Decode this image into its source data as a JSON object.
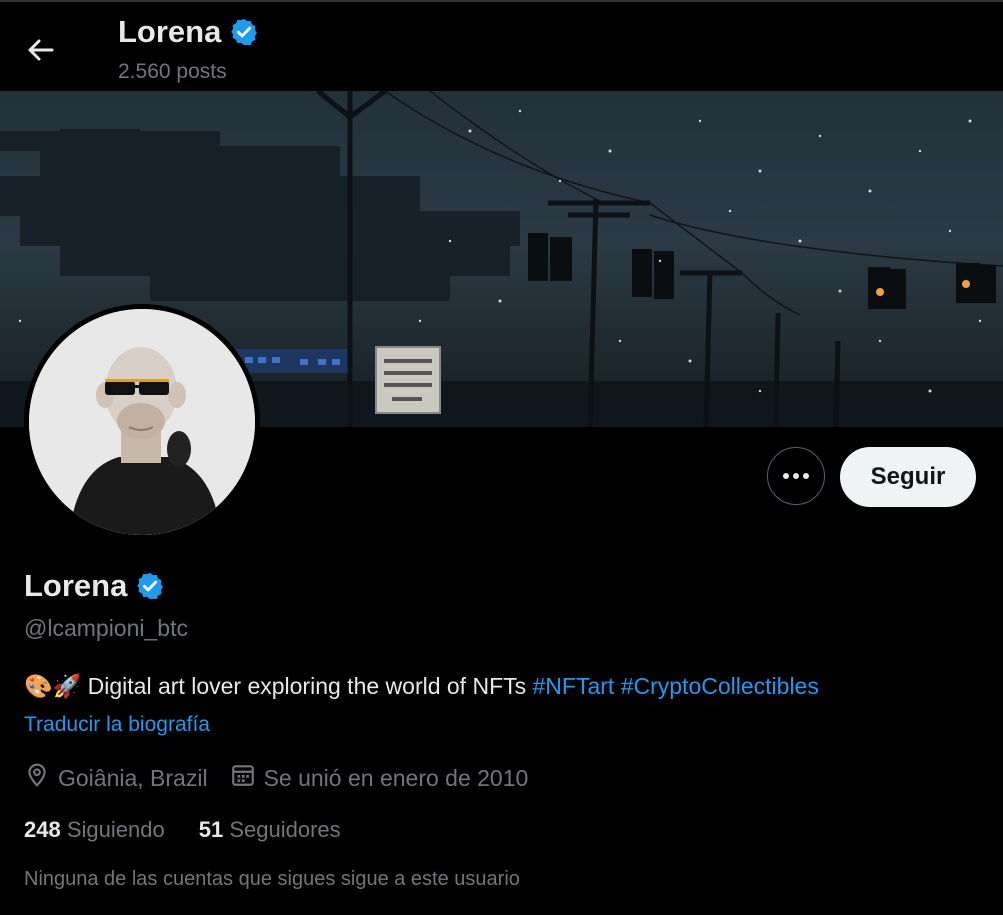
{
  "header": {
    "name": "Lorena",
    "posts_count": "2.560 posts"
  },
  "profile": {
    "name": "Lorena",
    "handle": "@lcampioni_btc",
    "bio_emojis": "🎨🚀",
    "bio_text": "Digital art lover exploring the world of NFTs",
    "hashtags": [
      "#NFTart",
      "#CryptoCollectibles"
    ],
    "translate_label": "Traducir la biografía",
    "location": "Goiânia, Brazil",
    "joined": "Se unió en enero de 2010",
    "following_count": "248",
    "following_label": "Siguiendo",
    "followers_count": "51",
    "followers_label": "Seguidores",
    "followers_you_know": "Ninguna de las cuentas que sigues sigue a este usuario"
  },
  "actions": {
    "follow_label": "Seguir"
  },
  "colors": {
    "accent": "#1d9bf0",
    "background": "#000000",
    "text": "#e7e9ea",
    "muted": "#71767b"
  },
  "icons": {
    "back": "arrow-left-icon",
    "verified": "verified-badge-icon",
    "more": "more-horizontal-icon",
    "location": "location-pin-icon",
    "calendar": "calendar-icon"
  }
}
